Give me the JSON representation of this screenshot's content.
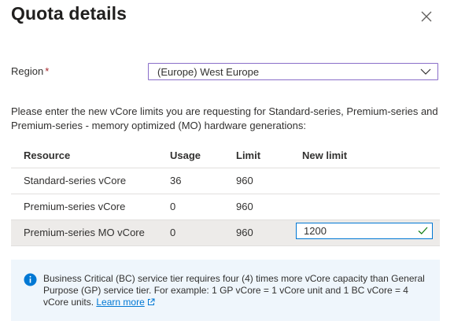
{
  "panel": {
    "title": "Quota details",
    "close_icon": "close-icon"
  },
  "region": {
    "label": "Region",
    "required_mark": "*",
    "selected": "(Europe) West Europe"
  },
  "instructions": "Please enter the new vCore limits you are requesting for Standard-series, Premium-series and Premium-series - memory optimized (MO) hardware generations:",
  "table": {
    "headers": {
      "resource": "Resource",
      "usage": "Usage",
      "limit": "Limit",
      "new_limit": "New limit"
    },
    "rows": [
      {
        "resource": "Standard-series vCore",
        "usage": "36",
        "limit": "960",
        "new_limit": ""
      },
      {
        "resource": "Premium-series vCore",
        "usage": "0",
        "limit": "960",
        "new_limit": ""
      },
      {
        "resource": "Premium-series MO vCore",
        "usage": "0",
        "limit": "960",
        "new_limit": "1200"
      }
    ]
  },
  "info": {
    "text": "Business Critical (BC) service tier requires four (4) times more vCore capacity than General Purpose (GP) service tier. For example: 1 GP vCore = 1 vCore unit and 1 BC vCore = 4 vCore units.",
    "link": "Learn more"
  },
  "colors": {
    "accent": "#0078d4",
    "required": "#a4262c",
    "valid_check": "#107c10",
    "info_bg": "#eff6fc",
    "selected_row": "#edebe9",
    "select_border": "#8a6ec9"
  }
}
